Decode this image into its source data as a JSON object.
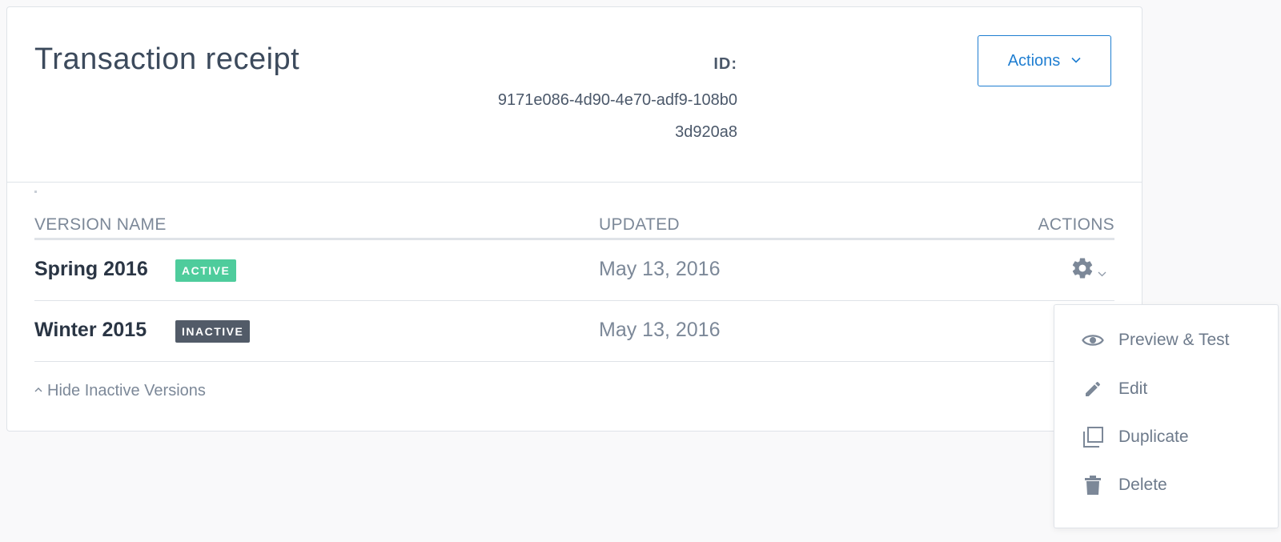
{
  "header": {
    "title": "Transaction receipt",
    "id_label": "ID:",
    "id_value": "9171e086-4d90-4e70-adf9-108b03d920a8",
    "actions_label": "Actions"
  },
  "table": {
    "columns": {
      "version_name": "VERSION NAME",
      "updated": "UPDATED",
      "actions": "ACTIONS"
    },
    "rows": [
      {
        "name": "Spring 2016",
        "status": "ACTIVE",
        "updated": "May 13, 2016"
      },
      {
        "name": "Winter 2015",
        "status": "INACTIVE",
        "updated": "May 13, 2016"
      }
    ]
  },
  "footer": {
    "hide_inactive_label": "Hide Inactive Versions"
  },
  "dropdown_menu": {
    "items": [
      {
        "label": "Preview & Test",
        "icon": "eye-icon"
      },
      {
        "label": "Edit",
        "icon": "pencil-icon"
      },
      {
        "label": "Duplicate",
        "icon": "duplicate-icon"
      },
      {
        "label": "Delete",
        "icon": "trash-icon"
      }
    ]
  },
  "colors": {
    "accent": "#1f7ed1",
    "active_badge": "#4ecc9c",
    "inactive_badge": "#525b68",
    "muted_text": "#7c8898"
  }
}
